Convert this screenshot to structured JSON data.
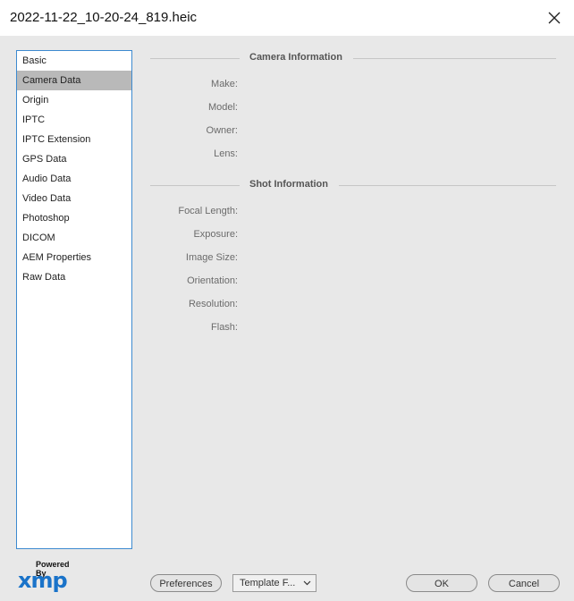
{
  "window": {
    "title": "2022-11-22_10-20-24_819.heic"
  },
  "sidebar": {
    "items": [
      {
        "label": "Basic"
      },
      {
        "label": "Camera Data",
        "selected": true
      },
      {
        "label": "Origin"
      },
      {
        "label": "IPTC"
      },
      {
        "label": "IPTC Extension"
      },
      {
        "label": "GPS Data"
      },
      {
        "label": "Audio Data"
      },
      {
        "label": "Video Data"
      },
      {
        "label": "Photoshop"
      },
      {
        "label": "DICOM"
      },
      {
        "label": "AEM Properties"
      },
      {
        "label": "Raw Data"
      }
    ]
  },
  "camera_info": {
    "heading": "Camera Information",
    "fields": [
      {
        "label": "Make:",
        "value": ""
      },
      {
        "label": "Model:",
        "value": ""
      },
      {
        "label": "Owner:",
        "value": ""
      },
      {
        "label": "Lens:",
        "value": ""
      }
    ]
  },
  "shot_info": {
    "heading": "Shot Information",
    "fields": [
      {
        "label": "Focal Length:",
        "value": ""
      },
      {
        "label": "Exposure:",
        "value": ""
      },
      {
        "label": "Image Size:",
        "value": ""
      },
      {
        "label": "Orientation:",
        "value": ""
      },
      {
        "label": "Resolution:",
        "value": ""
      },
      {
        "label": "Flash:",
        "value": ""
      }
    ]
  },
  "footer": {
    "powered_by": "Powered By",
    "logo_text": "xmp",
    "preferences_label": "Preferences",
    "template_label": "Template F...",
    "ok_label": "OK",
    "cancel_label": "Cancel"
  },
  "colors": {
    "accent": "#3d8ad0",
    "logo": "#1a73c9",
    "selected": "#b9b9b9"
  }
}
